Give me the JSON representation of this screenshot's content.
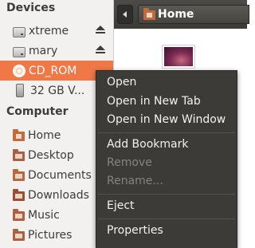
{
  "sidebar": {
    "devices_title": "Devices",
    "devices": [
      {
        "label": "xtreme",
        "icon": "drive-icon",
        "eject": true
      },
      {
        "label": "mary",
        "icon": "drive-icon",
        "eject": true
      },
      {
        "label": "CD_ROM",
        "icon": "cdrom-icon",
        "selected": true
      },
      {
        "label": "32 GB V...",
        "icon": "usb-icon"
      }
    ],
    "computer_title": "Computer",
    "places": [
      {
        "label": "Home",
        "icon": "home-folder-icon"
      },
      {
        "label": "Desktop",
        "icon": "desktop-folder-icon"
      },
      {
        "label": "Documents",
        "icon": "documents-folder-icon"
      },
      {
        "label": "Downloads",
        "icon": "downloads-folder-icon"
      },
      {
        "label": "Music",
        "icon": "music-folder-icon"
      },
      {
        "label": "Pictures",
        "icon": "pictures-folder-icon"
      }
    ]
  },
  "toolbar": {
    "breadcrumb": "Home"
  },
  "context_menu": {
    "items": [
      {
        "label": "Open",
        "enabled": true
      },
      {
        "label": "Open in New Tab",
        "enabled": true
      },
      {
        "label": "Open in New Window",
        "enabled": true
      },
      {
        "label": "Add Bookmark",
        "enabled": true
      },
      {
        "label": "Remove",
        "enabled": false
      },
      {
        "label": "Rename...",
        "enabled": false
      },
      {
        "label": "Eject",
        "enabled": true
      },
      {
        "label": "Properties",
        "enabled": true
      }
    ]
  },
  "colors": {
    "selection": "#f07746",
    "menu_background": "#3c3b37",
    "toolbar": "#3b3a37"
  }
}
